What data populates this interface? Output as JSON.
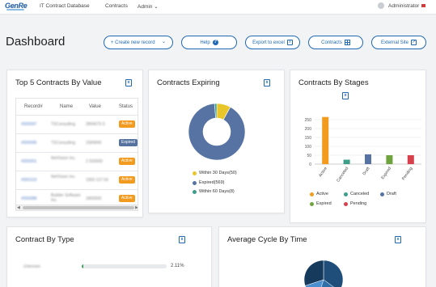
{
  "nav": {
    "logo": "GenRe",
    "app_title": "IT Contract Database",
    "contracts": "Contracts",
    "admin": "Admin ⌄",
    "user": "Administrator"
  },
  "header": {
    "title": "Dashboard",
    "buttons": {
      "create": "+ Create new record",
      "help": "Help",
      "export": "Export to excel",
      "contracts": "Contracts",
      "external": "External Site"
    }
  },
  "top5": {
    "title": "Top 5 Contracts By Value",
    "columns": [
      "Record#",
      "Name",
      "Value",
      "Status"
    ],
    "rows": [
      {
        "record": "#000097",
        "name": "TSConsulting",
        "value": "2894075.5",
        "status": "Active"
      },
      {
        "record": "#000095",
        "name": "TSConsulting",
        "value": "1589000",
        "status": "Expired"
      },
      {
        "record": "#000001",
        "name": "NetVision Inc.",
        "value": "2 500000",
        "status": "Active"
      },
      {
        "record": "#000103",
        "name": "NetVision Inc.",
        "value": "1900 137.54",
        "status": "Active"
      },
      {
        "record": "#000088",
        "name": "Builder Software Inc.",
        "value": "1800000",
        "status": "Active"
      }
    ]
  },
  "expiring": {
    "title": "Contracts Expiring",
    "legend": [
      {
        "label": "Within 30 Days(50)",
        "color": "#e8c62a"
      },
      {
        "label": "Expired(569)",
        "color": "#5673a3"
      },
      {
        "label": "Within 60 Days(8)",
        "color": "#3d9e8a"
      }
    ]
  },
  "stages": {
    "title": "Contracts By Stages",
    "legend": [
      {
        "label": "Active",
        "color": "#f39b1e"
      },
      {
        "label": "Canceled",
        "color": "#3d9e8a"
      },
      {
        "label": "Draft",
        "color": "#5673a3"
      },
      {
        "label": "Expired",
        "color": "#6fa33e"
      },
      {
        "label": "Pending",
        "color": "#d7414e"
      }
    ]
  },
  "contract_type": {
    "title": "Contract By Type",
    "row_label": "Unknown",
    "percent": "2.11%",
    "fraction": 0.0211
  },
  "cycle": {
    "title": "Average Cycle By Time"
  },
  "chart_data": [
    {
      "type": "pie",
      "title": "Contracts Expiring",
      "categories": [
        "Within 30 Days",
        "Expired",
        "Within 60 Days"
      ],
      "values": [
        50,
        569,
        8
      ],
      "colors": [
        "#e8c62a",
        "#5673a3",
        "#3d9e8a"
      ]
    },
    {
      "type": "bar",
      "title": "Contracts By Stages",
      "categories": [
        "Active",
        "Canceled",
        "Draft",
        "Expired",
        "Pending"
      ],
      "values": [
        265,
        25,
        55,
        50,
        50
      ],
      "colors": [
        "#f39b1e",
        "#3d9e8a",
        "#5673a3",
        "#6fa33e",
        "#d7414e"
      ],
      "yticks": [
        0,
        50,
        100,
        150,
        200,
        250
      ],
      "ylim": [
        0,
        300
      ],
      "grid": true
    },
    {
      "type": "pie",
      "title": "Average Cycle By Time",
      "values": [
        35,
        20,
        15,
        30
      ],
      "colors": [
        "#1f4e7a",
        "#2f6fa8",
        "#4a90d0",
        "#163a5c"
      ]
    }
  ]
}
